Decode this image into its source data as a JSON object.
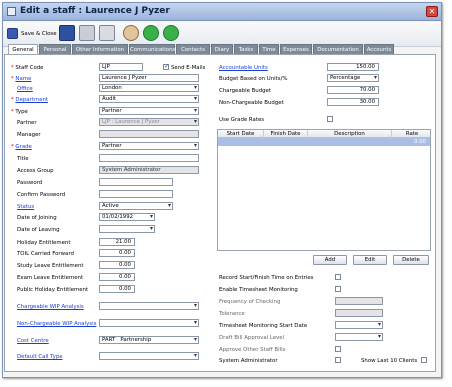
{
  "window": {
    "title": "Edit a staff : Laurence J Pyzer"
  },
  "toolbar": {
    "save_close": "Save & Close"
  },
  "tabs": [
    "General",
    "Personal",
    "Other Information",
    "Communications",
    "Contacts",
    "Diary",
    "Tasks",
    "Time",
    "Expenses",
    "Documentation",
    "Accounts"
  ],
  "left": {
    "staff_code": {
      "label": "Staff Code",
      "value": "LJP"
    },
    "send_email": {
      "label": "Send E-Mails",
      "checked": true
    },
    "name": {
      "label": "Name",
      "value": "Laurence J Pyzer"
    },
    "office": {
      "label": "Office",
      "value": "London"
    },
    "department": {
      "label": "Department",
      "value": "Audit"
    },
    "type": {
      "label": "Type",
      "value": "Partner"
    },
    "partner": {
      "label": "Partner",
      "value": "LJP : Laurence J Pyzer"
    },
    "manager": {
      "label": "Manager",
      "value": ""
    },
    "grade": {
      "label": "Grade",
      "value": "Partner"
    },
    "title": {
      "label": "Title",
      "value": ""
    },
    "access_group": {
      "label": "Access Group",
      "value": "System Administrator"
    },
    "password": {
      "label": "Password",
      "value": ""
    },
    "confirm_password": {
      "label": "Confirm Password",
      "value": ""
    },
    "status": {
      "label": "Status",
      "value": "Active"
    },
    "date_joining": {
      "label": "Date of Joining",
      "value": "01/02/1992"
    },
    "date_leaving": {
      "label": "Date of Leaving",
      "value": ""
    },
    "holiday": {
      "label": "Holiday Entitlement",
      "value": "21.00"
    },
    "toil": {
      "label": "TOIL Carried Forward",
      "value": "0.00"
    },
    "study": {
      "label": "Study Leave Entitlement",
      "value": "0.00"
    },
    "exam": {
      "label": "Exam Leave Entitlement",
      "value": "0.00"
    },
    "public_holiday": {
      "label": "Public Holiday Entitlement",
      "value": "0.00"
    },
    "chargeable_wip": {
      "label": "Chargeable WIP Analysis",
      "value": ""
    },
    "nonchargeable_wip": {
      "label": "Non-Chargeable WIP Analysis",
      "value": ""
    },
    "cost_centre": {
      "label": "Cost Centre",
      "code": "PART",
      "value": "Partnership"
    },
    "default_call_type": {
      "label": "Default Call Type",
      "value": ""
    }
  },
  "right": {
    "accountable_units": {
      "label": "Accountable Units",
      "value": "150.00"
    },
    "budget_based": {
      "label": "Budget Based on Units/%",
      "value": "Percentage"
    },
    "chargeable_budget": {
      "label": "Chargeable Budget",
      "value": "70.00"
    },
    "nonchargeable_budget": {
      "label": "Non-Chargeable Budget",
      "value": "30.00"
    },
    "use_grade_rates": {
      "label": "Use Grade Rates"
    },
    "grid": {
      "columns": [
        "Start Date",
        "Finish Date",
        "Description",
        "Rate"
      ],
      "rows": [
        {
          "rate": "0.00"
        }
      ]
    },
    "buttons": {
      "add": "Add",
      "edit": "Edit",
      "delete": "Delete"
    },
    "record_start_finish": {
      "label": "Record Start/Finish Time on Entries"
    },
    "enable_timesheet": {
      "label": "Enable Timesheet Monitoring"
    },
    "frequency": {
      "label": "Frequency of Checking"
    },
    "tolerance": {
      "label": "Tolerance"
    },
    "monitoring_start": {
      "label": "Timesheet Monitoring Start Date"
    },
    "draft_bill": {
      "label": "Draft Bill Approval Level"
    },
    "approve_other": {
      "label": "Approve Other Staff Bills"
    },
    "sys_admin": {
      "label": "System Administrator"
    },
    "show_last_clients": {
      "label": "Show Last 10 Clients"
    }
  },
  "colors": {
    "accent_link": "#1a3fd0",
    "required": "#cc0000",
    "grid_selected": "#a9bde5"
  }
}
